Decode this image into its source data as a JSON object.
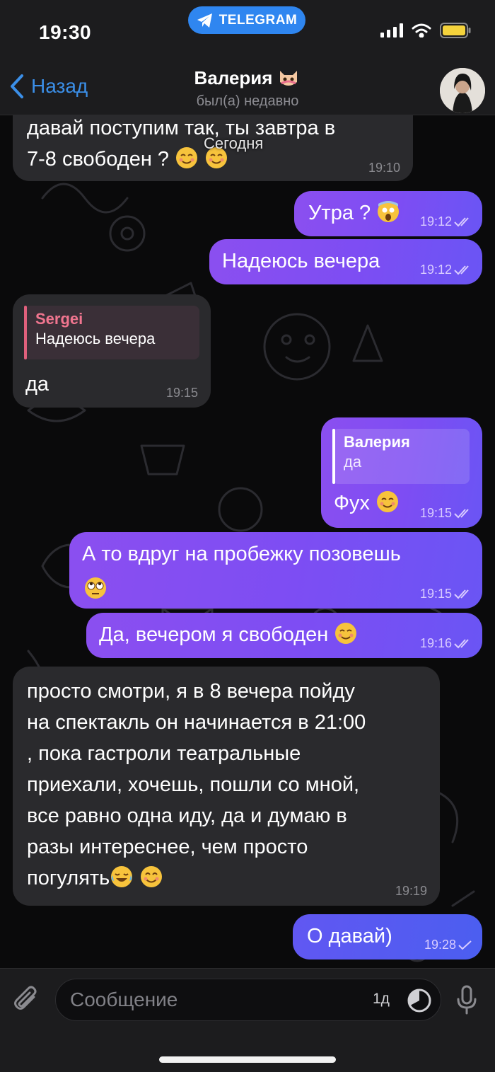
{
  "status_bar": {
    "time": "19:30",
    "app_pill": "TELEGRAM"
  },
  "header": {
    "back_label": "Назад",
    "chat_title": "Валерия",
    "chat_status": "был(а) недавно",
    "avatar_icon": "avatar-photo"
  },
  "date_chip": "Сегодня",
  "messages": [
    {
      "dir": "in",
      "lines": [
        "давай поступим так, ты завтра в",
        "7-8 свободен ?"
      ],
      "emoji": [
        "relieved-face-icon",
        "relieved-face-icon"
      ],
      "time": "19:10"
    },
    {
      "dir": "out",
      "lines": [
        "Утра ?"
      ],
      "emoji": [
        "scream-face-icon"
      ],
      "time": "19:12",
      "ticks": "double"
    },
    {
      "dir": "out",
      "lines": [
        "Надеюсь вечера"
      ],
      "time": "19:12",
      "ticks": "double"
    },
    {
      "dir": "in",
      "reply": {
        "name": "Sergei",
        "text": "Надеюсь вечера"
      },
      "lines": [
        "да"
      ],
      "time": "19:15"
    },
    {
      "dir": "out",
      "reply": {
        "name": "Валерия",
        "text": "да"
      },
      "lines": [
        "Фух"
      ],
      "emoji": [
        "relieved-face-icon"
      ],
      "time": "19:15",
      "ticks": "double"
    },
    {
      "dir": "out",
      "lines": [
        "А то вдруг на пробежку позовешь"
      ],
      "emoji": [
        "rolling-eyes-icon"
      ],
      "time": "19:15",
      "ticks": "double"
    },
    {
      "dir": "out",
      "lines": [
        "Да, вечером я свободен"
      ],
      "emoji": [
        "relieved-face-icon"
      ],
      "time": "19:16",
      "ticks": "double"
    },
    {
      "dir": "in",
      "lines": [
        "просто смотри, я в 8 вечера пойду",
        "на спектакль он начинается в 21:00",
        ", пока гастроли театральные",
        "приехали, хочешь, пошли со мной,",
        "все равно одна иду, да и думаю в",
        "разы интереснее, чем просто",
        "погулять"
      ],
      "emoji": [
        "tears-of-joy-icon",
        "smiling-face-icon"
      ],
      "time": "19:19"
    },
    {
      "dir": "out",
      "lines": [
        "О давай)"
      ],
      "time": "19:28",
      "ticks": "single"
    }
  ],
  "composer": {
    "placeholder": "Сообщение",
    "timer_label": "1д"
  },
  "colors": {
    "accent": "#3b8fe8",
    "outgoing_bubble": "#8b4ff0",
    "incoming_bubble": "#2a2a2d",
    "background": "#0a0a0b"
  }
}
